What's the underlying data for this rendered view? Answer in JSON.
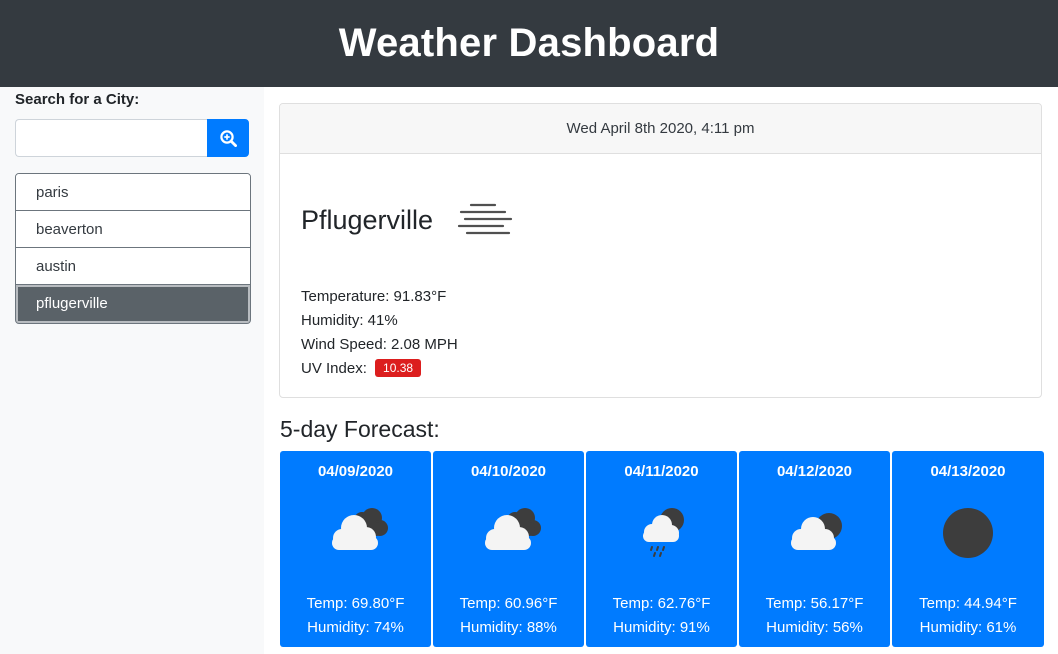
{
  "header": {
    "title": "Weather Dashboard"
  },
  "sidebar": {
    "search_label": "Search for a City:",
    "search_placeholder": "",
    "search_icon": "search-plus-icon",
    "cities": [
      "paris",
      "beaverton",
      "austin",
      "pflugerville"
    ],
    "active_city": "pflugerville"
  },
  "current": {
    "datetime": "Wed April 8th 2020, 4:11 pm",
    "city": "Pflugerville",
    "icon": "mist-icon",
    "temperature": "Temperature: 91.83°F",
    "humidity": "Humidity: 41%",
    "wind": "Wind Speed: 2.08 MPH",
    "uv_label": "UV Index:",
    "uv_value": "10.38"
  },
  "forecast": {
    "title": "5-day Forecast:",
    "days": [
      {
        "date": "04/09/2020",
        "icon": "broken-clouds-icon",
        "temp": "Temp: 69.80°F",
        "humidity": "Humidity: 74%"
      },
      {
        "date": "04/10/2020",
        "icon": "broken-clouds-icon",
        "temp": "Temp: 60.96°F",
        "humidity": "Humidity: 88%"
      },
      {
        "date": "04/11/2020",
        "icon": "rain-icon",
        "temp": "Temp: 62.76°F",
        "humidity": "Humidity: 91%"
      },
      {
        "date": "04/12/2020",
        "icon": "partly-cloudy-icon",
        "temp": "Temp: 56.17°F",
        "humidity": "Humidity: 56%"
      },
      {
        "date": "04/13/2020",
        "icon": "clear-icon",
        "temp": "Temp: 44.94°F",
        "humidity": "Humidity: 61%"
      }
    ]
  },
  "colors": {
    "header_bg": "#343a40",
    "primary": "#007bff",
    "active_city_bg": "#5a6268",
    "uv_high": "#dc1e1e"
  }
}
